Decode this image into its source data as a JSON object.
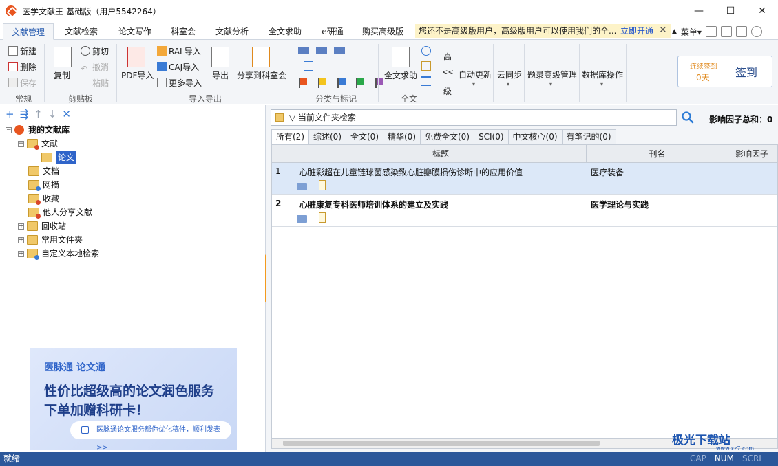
{
  "window": {
    "title": "医学文献王-基础版（用户5542264）",
    "minimize": "—",
    "maximize": "☐",
    "close": "✕"
  },
  "tabs": [
    "文献管理",
    "文献检索",
    "论文写作",
    "科室会",
    "文献分析",
    "全文求助",
    "e研通",
    "购买高级版"
  ],
  "notice": {
    "text": "您还不是高级版用户，高级版用户可以使用我们的全...",
    "link": "立即开通",
    "close": "✕"
  },
  "menu_right": {
    "collapse": "▲",
    "menu": "菜单▾"
  },
  "ribbon": {
    "group_normal": {
      "label": "常规",
      "new": "新建",
      "delete": "删除",
      "save": "保存"
    },
    "group_clipboard": {
      "label": "剪贴板",
      "copy": "复制",
      "cut": "剪切",
      "undo": "撤消",
      "paste": "粘贴"
    },
    "group_import": {
      "label": "导入导出",
      "pdf": "PDF导入",
      "ral": "RAL导入",
      "caj": "CAJ导入",
      "more": "更多导入",
      "export": "导出",
      "share": "分享到科室会"
    },
    "group_classify": {
      "label": "分类与标记"
    },
    "group_fulltext": {
      "label": "全文",
      "help": "全文求助"
    },
    "advanced": {
      "high": "高",
      "arrows": "<<",
      "level": "级"
    },
    "auto_update": "自动更新",
    "cloud_sync": "云同步",
    "title_adv": "题录高级管理",
    "db_ops": "数据库操作",
    "checkin": {
      "streak": "连续签到",
      "days": "0天",
      "button": "签到"
    }
  },
  "tree": {
    "toolbar": [
      "+",
      "⇶",
      "↑",
      "↓",
      "✕"
    ],
    "root": "我的文献库",
    "items": [
      {
        "label": "文献",
        "expander": "⊟"
      },
      {
        "label": "论文"
      },
      {
        "label": "文档"
      },
      {
        "label": "网摘"
      },
      {
        "label": "收藏"
      },
      {
        "label": "他人分享文献"
      },
      {
        "label": "回收站",
        "expander": "⊞"
      },
      {
        "label": "常用文件夹",
        "expander": "⊞"
      },
      {
        "label": "自定义本地检索",
        "expander": "⊞"
      }
    ]
  },
  "ad": {
    "logo": "医脉通 论文通",
    "line1": "性价比超级高的论文润色服务",
    "line2": "下单加赠科研卡！",
    "button": "医脉通论文服务帮你优化稿件，顺利发表>>"
  },
  "search": {
    "scope": "▽ 当前文件夹检索",
    "impact_label": "影响因子总和：0"
  },
  "filter_tabs": [
    "所有(2)",
    "综述(0)",
    "全文(0)",
    "精华(0)",
    "免费全文(0)",
    "SCI(0)",
    "中文核心(0)",
    "有笔记的(0)"
  ],
  "table": {
    "columns": [
      "标题",
      "刊名",
      "影响因子"
    ],
    "rows": [
      {
        "num": "1",
        "title": "心脏彩超在儿童链球菌感染致心脏瓣膜损伤诊断中的应用价值",
        "journal": "医疗装备"
      },
      {
        "num": "2",
        "title": "心脏康复专科医师培训体系的建立及实践",
        "journal": "医学理论与实践"
      }
    ]
  },
  "status": {
    "left": "就绪",
    "cap": "CAP",
    "num": "NUM",
    "scrl": "SCRL"
  },
  "watermark": {
    "title": "极光下载站",
    "sub": "www.xz7.com"
  }
}
